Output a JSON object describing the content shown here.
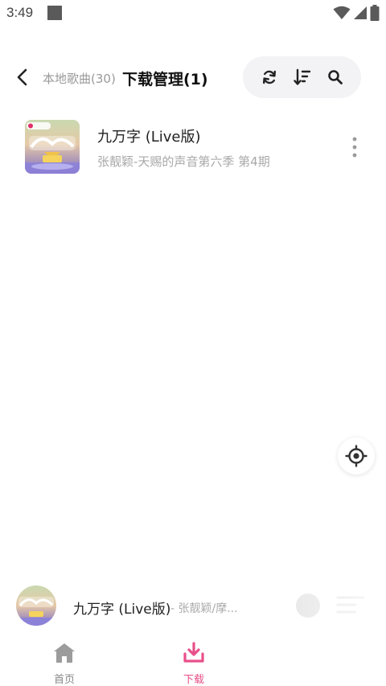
{
  "status_bar": {
    "time": "3:49"
  },
  "header": {
    "local_tab_label": "本地歌曲",
    "local_tab_count": "(30)",
    "download_tab_label": "下载管理(1)"
  },
  "songs": [
    {
      "title": "九万字 (Live版)",
      "subtitle": "张靓颖-天赐的声音第六季 第4期"
    }
  ],
  "mini_player": {
    "title": "九万字 (Live版)",
    "artist": "- 张靓颖/摩..."
  },
  "bottom_nav": {
    "items": [
      {
        "label": "首页",
        "active": false
      },
      {
        "label": "下载",
        "active": true
      }
    ]
  },
  "colors": {
    "accent": "#e8508a",
    "toolbar_bg": "#f3f3f5",
    "secondary_text": "#a9a9a9"
  },
  "icons": {
    "back": "chevron-left-icon",
    "refresh": "refresh-icon",
    "sort": "sort-icon",
    "search": "search-icon",
    "more": "more-vertical-icon",
    "locate": "locate-icon",
    "home": "home-icon",
    "download": "download-icon"
  }
}
